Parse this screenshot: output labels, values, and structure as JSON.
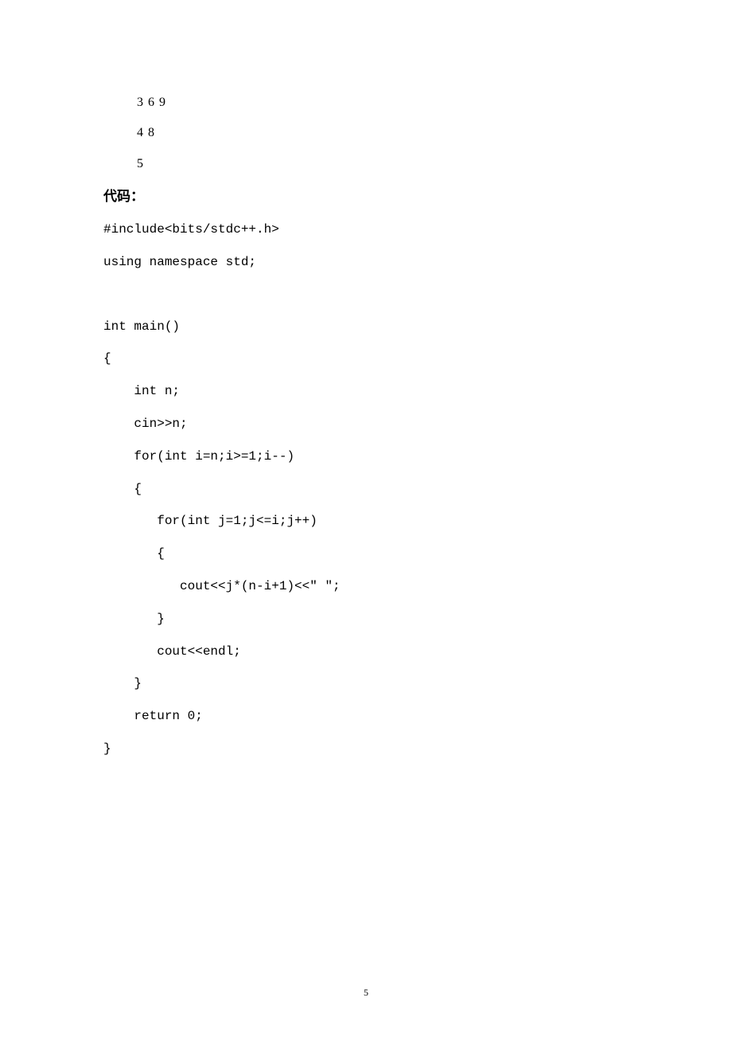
{
  "output": {
    "line1": "3 6 9",
    "line2": "4 8",
    "line3": "5"
  },
  "labels": {
    "code_heading": "代码："
  },
  "code": {
    "l01": "#include<bits/stdc++.h>",
    "l02": "using namespace std;",
    "l03": "int main()",
    "l04": "{",
    "l05": "    int n;",
    "l06": "    cin>>n;",
    "l07": "    for(int i=n;i>=1;i--)",
    "l08": "    {",
    "l09": "       for(int j=1;j<=i;j++)",
    "l10": "       {",
    "l11": "          cout<<j*(n-i+1)<<\" \";",
    "l12": "       }",
    "l13": "       cout<<endl;",
    "l14": "    }",
    "l15": "    return 0;",
    "l16": "}"
  },
  "page_number": "5"
}
